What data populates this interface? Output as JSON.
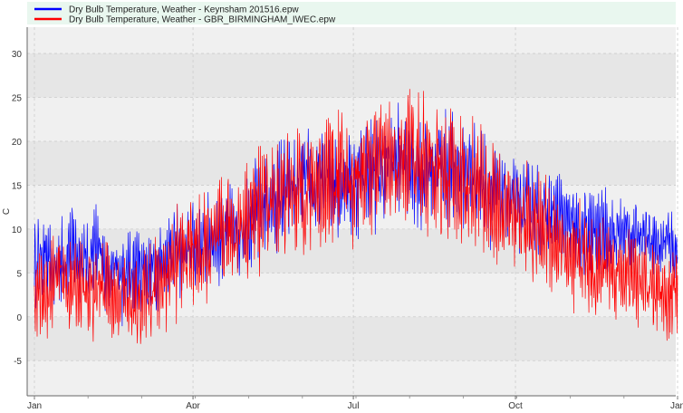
{
  "chart_data": {
    "type": "line",
    "title": "",
    "xlabel": "",
    "ylabel": "C",
    "ylim": [
      -9,
      33
    ],
    "y_ticks": [
      -5,
      0,
      5,
      10,
      15,
      20,
      25,
      30
    ],
    "x_ticks": [
      {
        "label": "Jan",
        "day": 0
      },
      {
        "label": "Apr",
        "day": 90
      },
      {
        "label": "Jul",
        "day": 181
      },
      {
        "label": "Oct",
        "day": 273
      },
      {
        "label": "Jan",
        "day": 365
      }
    ],
    "xlim_days": [
      0,
      365
    ],
    "grid": true,
    "legend_position": "top",
    "background_bands": [
      "#f0f0f0",
      "#e6e6e6"
    ],
    "series": [
      {
        "name": "Dry Bulb Temperature, Weather - Keynsham 201516.epw",
        "color": "#0000ff",
        "x_days": [
          0,
          5,
          10,
          15,
          20,
          25,
          30,
          35,
          40,
          45,
          50,
          55,
          60,
          65,
          70,
          75,
          80,
          85,
          90,
          95,
          100,
          105,
          110,
          115,
          120,
          125,
          130,
          135,
          140,
          145,
          150,
          155,
          160,
          165,
          170,
          175,
          180,
          185,
          190,
          195,
          200,
          205,
          210,
          215,
          220,
          225,
          230,
          235,
          240,
          245,
          250,
          255,
          260,
          265,
          270,
          275,
          280,
          285,
          290,
          295,
          300,
          305,
          310,
          315,
          320,
          325,
          330,
          335,
          340,
          345,
          350,
          355,
          360,
          365
        ],
        "values": [
          6,
          7,
          5,
          6,
          8,
          7,
          6,
          8,
          5,
          6,
          4,
          5,
          6,
          5,
          6,
          7,
          8,
          7,
          8,
          8,
          9,
          9,
          10,
          9,
          11,
          12,
          13,
          13,
          14,
          14,
          15,
          15,
          14,
          16,
          15,
          16,
          15,
          16,
          17,
          16,
          17,
          18,
          17,
          17,
          16,
          17,
          18,
          17,
          16,
          17,
          16,
          15,
          14,
          14,
          13,
          12,
          13,
          12,
          11,
          12,
          11,
          10,
          9,
          10,
          9,
          10,
          9,
          10,
          9,
          10,
          9,
          8,
          9,
          7
        ],
        "amplitude": [
          4,
          4,
          4,
          4,
          4,
          4,
          4,
          4,
          4,
          3,
          4,
          4,
          4,
          4,
          4,
          4,
          4,
          4,
          4,
          4,
          4,
          4,
          4,
          4,
          4,
          5,
          5,
          5,
          5,
          5,
          5,
          5,
          5,
          5,
          5,
          5,
          5,
          5,
          5,
          5,
          5,
          5,
          5,
          5,
          5,
          5,
          5,
          5,
          5,
          5,
          5,
          5,
          5,
          4,
          4,
          4,
          4,
          4,
          4,
          4,
          4,
          4,
          4,
          4,
          4,
          4,
          3,
          3,
          3,
          3,
          3,
          3,
          3,
          3
        ]
      },
      {
        "name": "Dry Bulb Temperature, Weather - GBR_BIRMINGHAM_IWEC.epw",
        "color": "#ff0000",
        "x_days": [
          0,
          5,
          10,
          15,
          20,
          25,
          30,
          35,
          40,
          45,
          50,
          55,
          60,
          65,
          70,
          75,
          80,
          85,
          90,
          95,
          100,
          105,
          110,
          115,
          120,
          125,
          130,
          135,
          140,
          145,
          150,
          155,
          160,
          165,
          170,
          175,
          180,
          185,
          190,
          195,
          200,
          205,
          210,
          215,
          220,
          225,
          230,
          235,
          240,
          245,
          250,
          255,
          260,
          265,
          270,
          275,
          280,
          285,
          290,
          295,
          300,
          305,
          310,
          315,
          320,
          325,
          330,
          335,
          340,
          345,
          350,
          355,
          360,
          365
        ],
        "values": [
          3,
          2,
          4,
          5,
          3,
          4,
          2,
          3,
          4,
          2,
          3,
          1,
          2,
          3,
          4,
          5,
          6,
          7,
          8,
          7,
          8,
          9,
          10,
          10,
          11,
          12,
          13,
          13,
          14,
          14,
          15,
          14,
          15,
          16,
          16,
          16,
          15,
          17,
          17,
          18,
          17,
          17,
          18,
          19,
          18,
          17,
          16,
          16,
          16,
          15,
          15,
          14,
          13,
          12,
          12,
          11,
          11,
          10,
          10,
          9,
          8,
          5,
          7,
          6,
          5,
          6,
          5,
          5,
          4,
          4,
          3,
          3,
          2,
          3
        ],
        "amplitude": [
          4,
          4,
          4,
          4,
          4,
          4,
          4,
          4,
          4,
          4,
          4,
          4,
          4,
          5,
          5,
          5,
          5,
          5,
          5,
          5,
          5,
          5,
          5,
          5,
          5,
          6,
          6,
          6,
          6,
          6,
          6,
          6,
          6,
          6,
          6,
          6,
          6,
          6,
          6,
          6,
          6,
          6,
          6,
          6,
          6,
          6,
          6,
          6,
          6,
          6,
          6,
          6,
          6,
          5,
          5,
          5,
          5,
          5,
          5,
          5,
          5,
          5,
          5,
          5,
          5,
          5,
          4,
          4,
          4,
          4,
          4,
          4,
          4,
          4
        ]
      }
    ]
  }
}
